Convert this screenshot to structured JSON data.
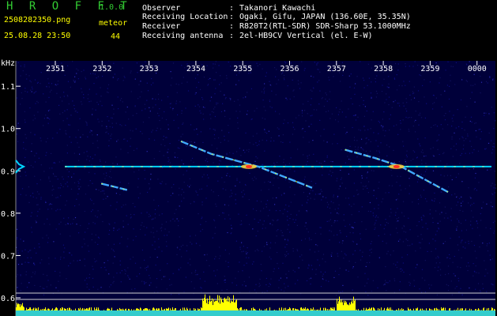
{
  "app": {
    "title": "H R O F F T",
    "version": "1.0.0"
  },
  "file": {
    "name": "2508282350.png",
    "datetime": "25.08.28 23:50"
  },
  "meteor": {
    "label": "meteor",
    "count": "44"
  },
  "info": {
    "rows": [
      {
        "label": "Observer",
        "value": "Takanori Kawachi"
      },
      {
        "label": "Receiving Location",
        "value": "Ogaki, Gifu, JAPAN (136.60E, 35.35N)"
      },
      {
        "label": "Receiver",
        "value": "R820T2(RTL-SDR) SDR-Sharp 53.1000MHz"
      },
      {
        "label": "Receiving antenna",
        "value": "2el-HB9CV Vertical (el. E-W)"
      }
    ],
    "colon": ":"
  },
  "colors": {
    "title": "#33cc33",
    "text_white": "#ffffff",
    "text_yellow": "#ffff00",
    "bg": "#000000",
    "plot_bg": "#00003a",
    "grid": "#ffffff"
  },
  "chart_data": {
    "type": "heatmap",
    "title": "",
    "ylabel": "kHz",
    "ytick_labels": [
      "1.1",
      "1.0",
      "0.9",
      "0.8",
      "0.7",
      "0.6"
    ],
    "yticks": [
      1.1,
      1.0,
      0.9,
      0.8,
      0.7,
      0.6
    ],
    "ylim": [
      0.6,
      1.16
    ],
    "xtick_labels": [
      "2351",
      "2352",
      "2353",
      "2354",
      "2355",
      "2356",
      "2357",
      "2358",
      "2359",
      "0000"
    ],
    "xlim": [
      0,
      10
    ],
    "carrier_freq": 0.91,
    "echoes": [
      {
        "x": [
          2.85,
          3.5,
          4.5,
          5.65
        ],
        "y": [
          0.97,
          0.94,
          0.91,
          0.86
        ]
      },
      {
        "x": [
          6.35,
          7.0,
          7.55,
          8.55
        ],
        "y": [
          0.95,
          0.93,
          0.91,
          0.85
        ]
      },
      {
        "x": [
          1.15,
          1.7
        ],
        "y": [
          0.87,
          0.855
        ]
      }
    ]
  }
}
